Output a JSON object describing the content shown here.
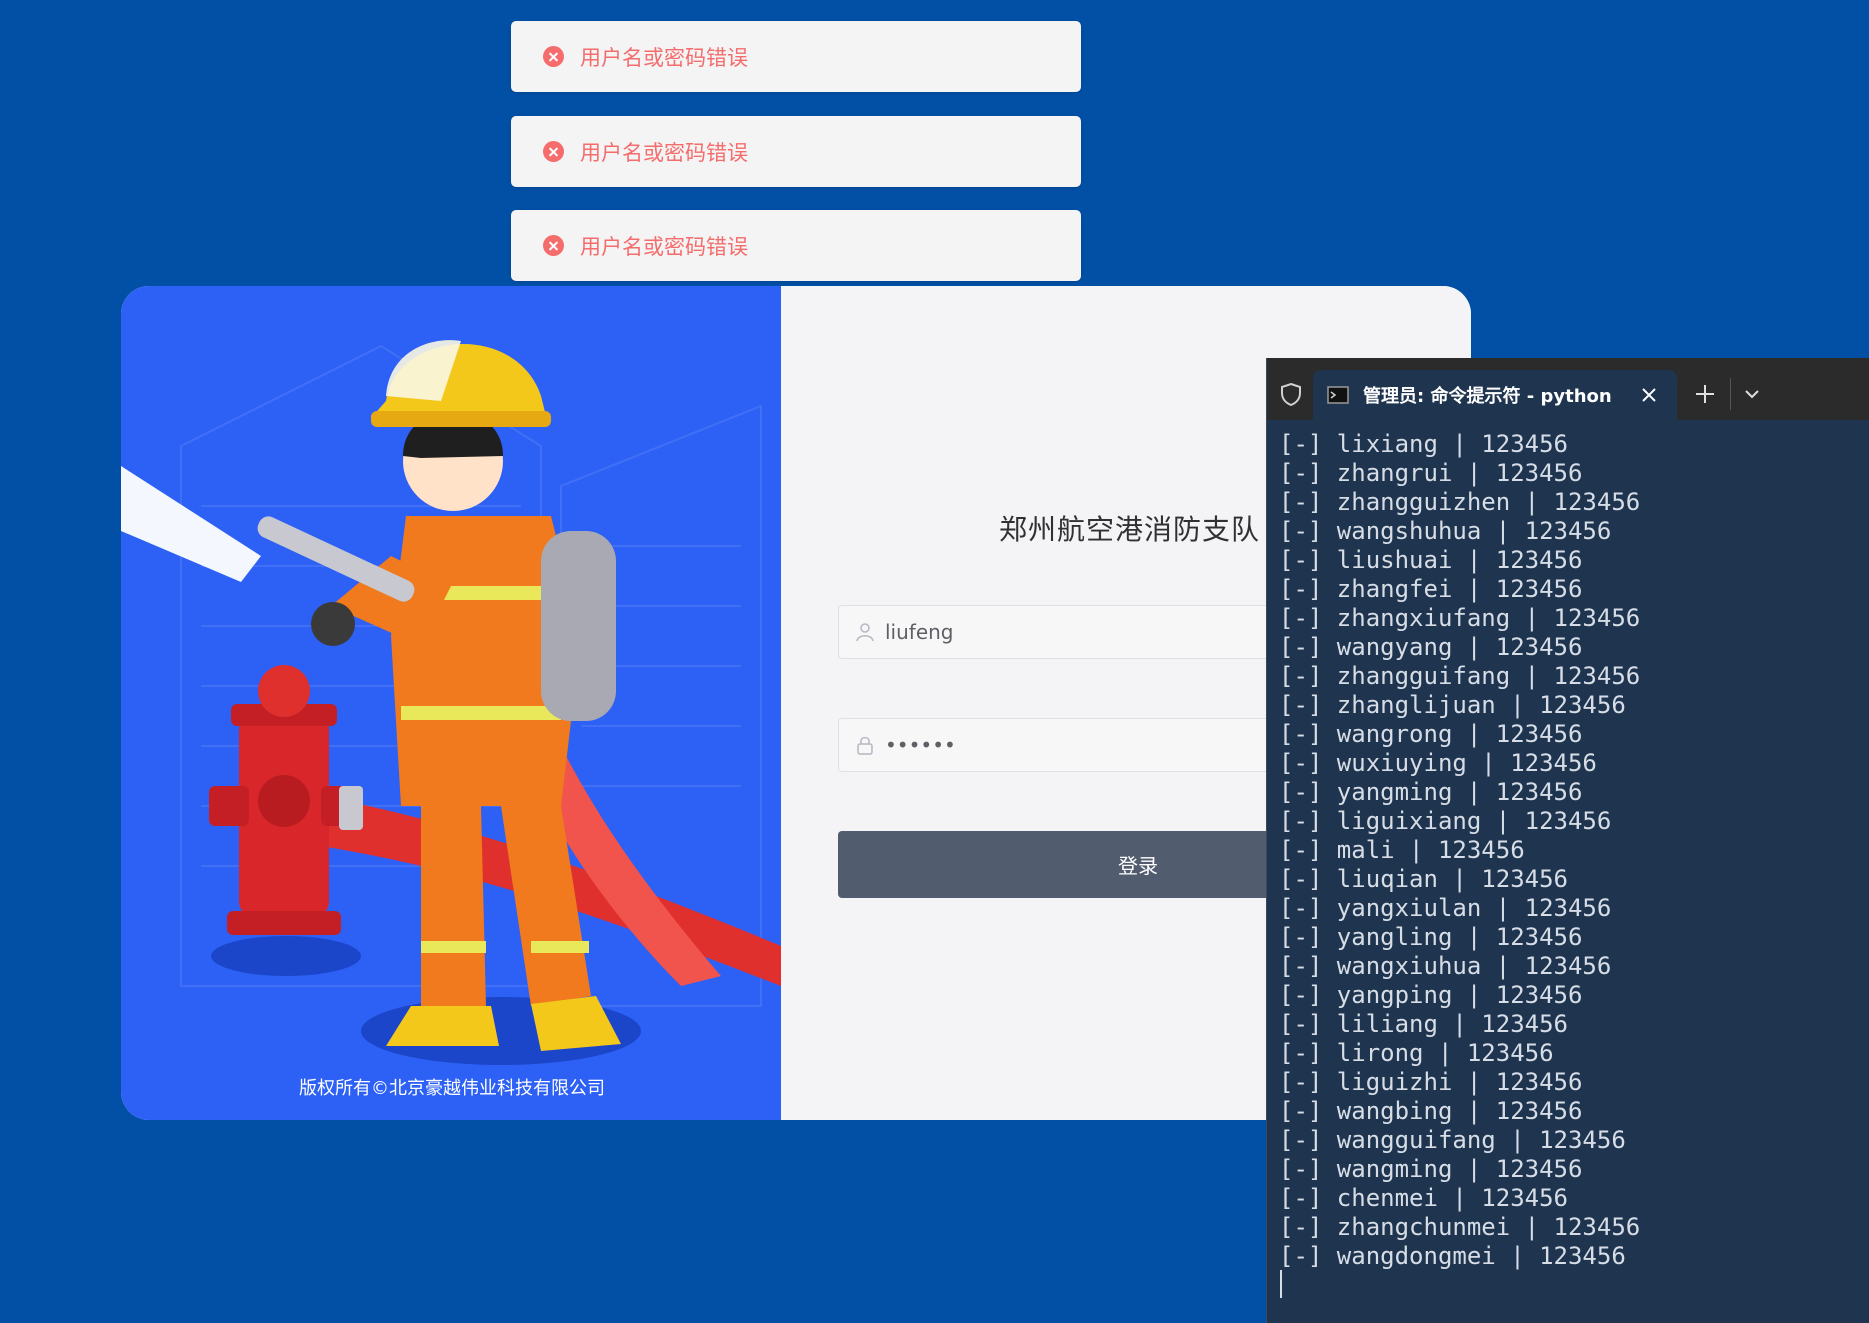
{
  "toasts": [
    {
      "message": "用户名或密码错误"
    },
    {
      "message": "用户名或密码错误"
    },
    {
      "message": "用户名或密码错误"
    }
  ],
  "login": {
    "title": "郑州航空港消防支队",
    "username_value": "liufeng",
    "password_value": "••••••",
    "submit_label": "登录",
    "copyright": "版权所有©北京豪越伟业科技有限公司"
  },
  "terminal": {
    "tab_title": "管理员: 命令提示符 - python c",
    "lines": [
      "[-] lixiang | 123456",
      "[-] zhangrui | 123456",
      "[-] zhangguizhen | 123456",
      "[-] wangshuhua | 123456",
      "[-] liushuai | 123456",
      "[-] zhangfei | 123456",
      "[-] zhangxiufang | 123456",
      "[-] wangyang | 123456",
      "[-] zhangguifang | 123456",
      "[-] zhanglijuan | 123456",
      "[-] wangrong | 123456",
      "[-] wuxiuying | 123456",
      "[-] yangming | 123456",
      "[-] liguixiang | 123456",
      "[-] mali | 123456",
      "[-] liuqian | 123456",
      "[-] yangxiulan | 123456",
      "[-] yangling | 123456",
      "[-] wangxiuhua | 123456",
      "[-] yangping | 123456",
      "[-] liliang | 123456",
      "[-] lirong | 123456",
      "[-] liguizhi | 123456",
      "[-] wangbing | 123456",
      "[-] wangguifang | 123456",
      "[-] wangming | 123456",
      "[-] chenmei | 123456",
      "[-] zhangchunmei | 123456",
      "[-] wangdongmei | 123456"
    ]
  }
}
